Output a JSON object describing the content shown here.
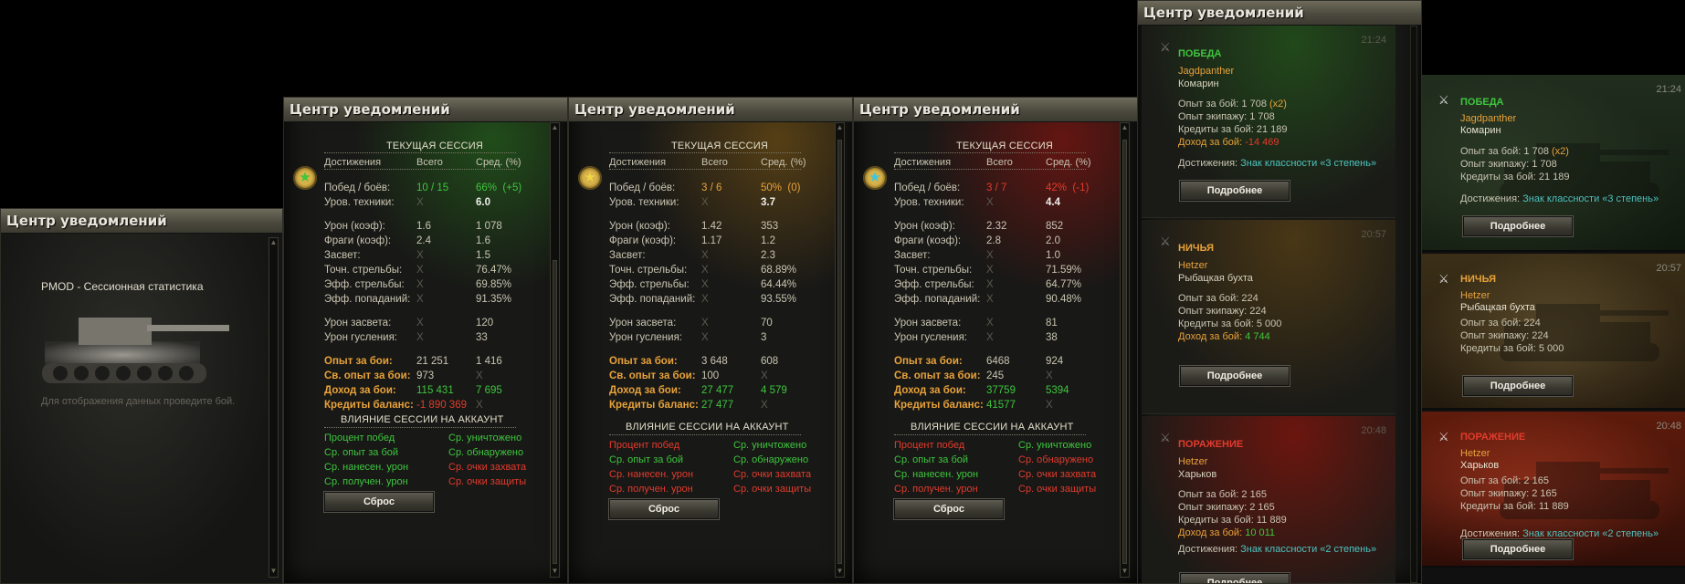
{
  "window_title": "Центр уведомлений",
  "win1": {
    "header": "PMOD - Сессионная статистика",
    "empty_text": "Для отображения данных проведите бой."
  },
  "session": {
    "title": "ТЕКУЩАЯ СЕССИЯ",
    "col_ach": "Достижения",
    "col_total": "Всего",
    "col_avg": "Сред. (%)",
    "labels": {
      "wins": "Побед / боёв:",
      "tier": "Уров. техники:",
      "dmg": "Урон (коэф):",
      "frags": "Фраги (коэф):",
      "spot": "Засвет:",
      "acc": "Точн. стрельбы:",
      "eff": "Эфф. стрельбы:",
      "pen": "Эфф. попаданий:",
      "spotdmg": "Урон засвета:",
      "trackdmg": "Урон гусления:",
      "xp": "Опыт за бои:",
      "fxp": "Св. опыт за бои:",
      "income": "Доход за бои:",
      "balance": "Кредиты баланс:"
    },
    "x": "X",
    "impact_title": "ВЛИЯНИЕ СЕССИИ НА АККАУНТ",
    "impact": [
      "Процент побед",
      "Ср. уничтожено",
      "Ср. опыт за бой",
      "Ср. обнаружено",
      "Ср. нанесен. урон",
      "Ср. очки захвата",
      "Ср. получен. урон",
      "Ср. очки защиты"
    ],
    "reset": "Сброс"
  },
  "s2": {
    "wins_total": "10 / 15",
    "wins_avg": "66%",
    "wins_delta": "(+5)",
    "tier_avg": "6.0",
    "dmg": [
      "1.6",
      "1 078"
    ],
    "frags": [
      "2.4",
      "1.6"
    ],
    "spot": "1.5",
    "acc": "76.47%",
    "eff": "69.85%",
    "pen": "91.35%",
    "spotdmg": "120",
    "trackdmg": "33",
    "xp": [
      "21 251",
      "1 416"
    ],
    "fxp": "973",
    "income": [
      "115 431",
      "7 695"
    ],
    "balance": "-1 890 369",
    "colors": {
      "c1": "g",
      "c2": "g",
      "c3": "g",
      "c4": "g",
      "c5": "g",
      "c6": "r",
      "c7": "g",
      "c8": "r"
    }
  },
  "s3": {
    "wins_total": "3 / 6",
    "wins_avg": "50%",
    "wins_delta": "(0)",
    "tier_avg": "3.7",
    "dmg": [
      "1.42",
      "353"
    ],
    "frags": [
      "1.17",
      "1.2"
    ],
    "spot": "2.3",
    "acc": "68.89%",
    "eff": "64.44%",
    "pen": "93.55%",
    "spotdmg": "70",
    "trackdmg": "3",
    "xp": [
      "3 648",
      "608"
    ],
    "fxp": "100",
    "income": [
      "27 477",
      "4 579"
    ],
    "balance": "27 477"
  },
  "s4": {
    "wins_total": "3 / 7",
    "wins_avg": "42%",
    "wins_delta": "(-1)",
    "tier_avg": "4.4",
    "dmg": [
      "2.32",
      "852"
    ],
    "frags": [
      "2.8",
      "2.0"
    ],
    "spot": "1.0",
    "acc": "71.59%",
    "eff": "64.77%",
    "pen": "90.48%",
    "spotdmg": "81",
    "trackdmg": "38",
    "xp": [
      "6468",
      "924"
    ],
    "fxp": "245",
    "income": [
      "37759",
      "5394"
    ],
    "balance": "41577"
  },
  "notifications": [
    {
      "result": "ПОБЕДА",
      "tank": "Jagdpanther",
      "map": "Комарин",
      "time": "21:24",
      "xp": "Опыт за бой: 1 708",
      "xp_mult": "(x2)",
      "crew": "Опыт экипажу: 1 708",
      "credits": "Кредиты за бой: 21 189",
      "income": "Доход за бой:",
      "income_val": "-14 469",
      "ach_label": "Достижения:",
      "ach": "Знак классности «3 степень»"
    },
    {
      "result": "НИЧЬЯ",
      "tank": "Hetzer",
      "map": "Рыбацкая бухта",
      "time": "20:57",
      "xp": "Опыт за бой: 224",
      "crew": "Опыт экипажу: 224",
      "credits": "Кредиты за бой: 5 000",
      "income": "Доход за бой:",
      "income_val": "4 744"
    },
    {
      "result": "ПОРАЖЕНИЕ",
      "tank": "Hetzer",
      "map": "Харьков",
      "time": "20:48",
      "xp": "Опыт за бой: 2 165",
      "crew": "Опыт экипажу: 2 165",
      "credits": "Кредиты за бой: 11 889",
      "income": "Доход за бой:",
      "income_val": "10 011",
      "ach_label": "Достижения:",
      "ach": "Знак классности «2 степень»"
    }
  ],
  "details_btn": "Подробнее",
  "colors": {
    "win": "#3ec63e",
    "draw": "#e8a23a",
    "loss": "#e23b2d",
    "teal": "#4ec3c0"
  },
  "icons": {
    "close": "crossed-swords-icon",
    "medal": "class-medal-icon"
  }
}
